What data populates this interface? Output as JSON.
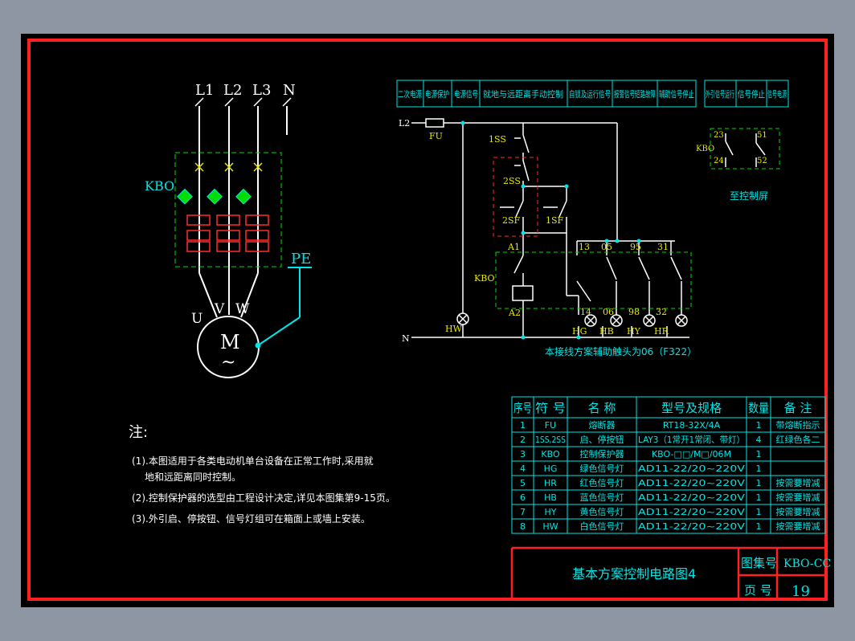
{
  "colors": {
    "background": "#8e96a4",
    "paper": "#000000",
    "frame": "#ff2020",
    "cyan": "#00e5e5",
    "white": "#ffffff",
    "green": "#00dd00",
    "yellow": "#e8e800",
    "red": "#ff2a2a"
  },
  "power": {
    "phases": [
      "L1",
      "L2",
      "L3",
      "N"
    ],
    "breaker_label": "KBO",
    "motor_terminals": [
      "U",
      "V",
      "W"
    ],
    "motor_symbol": "M",
    "motor_wave": "~",
    "pe_label": "PE"
  },
  "header_table": {
    "cells": [
      "二次电源",
      "电源保护",
      "电源信号",
      "就地与远距离手动控制",
      "自锁及运行信号",
      "报警信号短路故障",
      "辅助信号停止"
    ],
    "side_cells": [
      "外引信号运行",
      "信号停止",
      "信号电源"
    ]
  },
  "control": {
    "l2": "L2",
    "n": "N",
    "fu": "FU",
    "ss1": "1SS",
    "ss2": "2SS",
    "sf2": "2SF",
    "sf1": "1SF",
    "a1": "A1",
    "a2": "A2",
    "kbo": "KBO",
    "top_terminals": [
      "13",
      "05",
      "95",
      "31"
    ],
    "bottom_terminals": [
      "14",
      "06",
      "98",
      "32"
    ],
    "lamps": [
      "HW",
      "HG",
      "HB",
      "HY",
      "HR"
    ],
    "note": "本接线方案辅助触头为06（F322）"
  },
  "aux": {
    "label": "KBO",
    "t1": "23",
    "t2": "24",
    "t3": "51",
    "t4": "52",
    "caption": "至控制屏"
  },
  "notes": {
    "title": "注:",
    "lines": [
      "(1).本图适用于各类电动机单台设备在正常工作时,采用就",
      "地和远距离同时控制。",
      "(2).控制保护器的选型由工程设计决定,详见本图集第9-15页。",
      "(3).外引启、停按钮、信号灯组可在箱面上或墙上安装。"
    ]
  },
  "parts_table": {
    "headers": [
      "序号",
      "符 号",
      "名 称",
      "型号及规格",
      "数量",
      "备 注"
    ],
    "rows": [
      [
        "1",
        "FU",
        "熔断器",
        "RT18-32X/4A",
        "1",
        "带熔断指示"
      ],
      [
        "2",
        "1SS,2SS",
        "启、停按钮",
        "LAY3（1常开1常闭、带灯）",
        "4",
        "红绿色各二"
      ],
      [
        "3",
        "KBO",
        "控制保护器",
        "KBO-□□/M□/06M",
        "1",
        ""
      ],
      [
        "4",
        "HG",
        "绿色信号灯",
        "AD11-22/20~220V",
        "1",
        ""
      ],
      [
        "5",
        "HR",
        "红色信号灯",
        "AD11-22/20~220V",
        "1",
        "按需要增减"
      ],
      [
        "6",
        "HB",
        "蓝色信号灯",
        "AD11-22/20~220V",
        "1",
        "按需要增减"
      ],
      [
        "7",
        "HY",
        "黄色信号灯",
        "AD11-22/20~220V",
        "1",
        "按需要增减"
      ],
      [
        "8",
        "HW",
        "白色信号灯",
        "AD11-22/20~220V",
        "1",
        "按需要增减"
      ]
    ]
  },
  "title_block": {
    "title": "基本方案控制电路图4",
    "atlas_label": "图集号",
    "atlas_value": "KBO-CC",
    "page_label": "页 号",
    "page_value": "19"
  }
}
